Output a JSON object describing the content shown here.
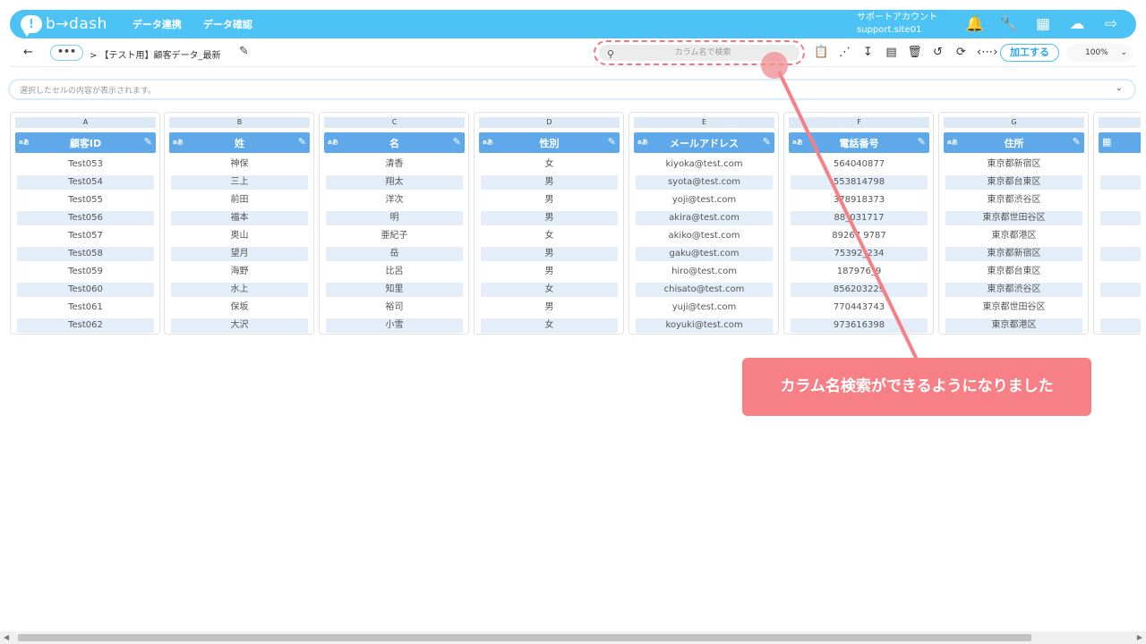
{
  "app": {
    "logo_mark": "!",
    "logo_text": "b→dash",
    "nav": [
      "データ連携",
      "データ確認"
    ],
    "account_name": "サポートアカウント",
    "account_site": "support.site01"
  },
  "top_icons": [
    "bell-icon",
    "wrench-icon",
    "grid-icon",
    "chat-icon",
    "logout-icon"
  ],
  "toolbar": {
    "back": "←",
    "more": "•••",
    "breadcrumb": "> 【テスト用】顧客データ_最新",
    "search_placeholder": "カラム名で検索",
    "process_button": "加工する",
    "zoom": "100%"
  },
  "cellbar": {
    "text": "選択したセルの内容が表示されます。"
  },
  "columns": [
    {
      "letter": "A",
      "type": "aあ",
      "name": "顧客ID",
      "cells": [
        "Test053",
        "Test054",
        "Test055",
        "Test056",
        "Test057",
        "Test058",
        "Test059",
        "Test060",
        "Test061",
        "Test062"
      ]
    },
    {
      "letter": "B",
      "type": "aあ",
      "name": "姓",
      "cells": [
        "神保",
        "三上",
        "前田",
        "福本",
        "奥山",
        "望月",
        "海野",
        "水上",
        "保坂",
        "大沢"
      ]
    },
    {
      "letter": "C",
      "type": "aあ",
      "name": "名",
      "cells": [
        "清香",
        "翔太",
        "洋次",
        "明",
        "亜紀子",
        "岳",
        "比呂",
        "知里",
        "裕司",
        "小雪"
      ]
    },
    {
      "letter": "D",
      "type": "aあ",
      "name": "性別",
      "cells": [
        "女",
        "男",
        "男",
        "男",
        "女",
        "男",
        "男",
        "女",
        "男",
        "女"
      ]
    },
    {
      "letter": "E",
      "type": "aあ",
      "name": "メールアドレス",
      "cells": [
        "kiyoka@test.com",
        "syota@test.com",
        "yoji@test.com",
        "akira@test.com",
        "akiko@test.com",
        "gaku@test.com",
        "hiro@test.com",
        "chisato@test.com",
        "yuji@test.com",
        "koyuki@test.com"
      ]
    },
    {
      "letter": "F",
      "type": "aあ",
      "name": "電話番号",
      "cells": [
        "564040877",
        "553814798",
        "378918373",
        "88_031717",
        "89267 9787",
        "75392_234",
        "187976_9",
        "856203229",
        "770443743",
        "973616398"
      ]
    },
    {
      "letter": "G",
      "type": "aあ",
      "name": "住所",
      "cells": [
        "東京都新宿区",
        "東京都台東区",
        "東京都渋谷区",
        "東京都世田谷区",
        "東京都港区",
        "東京都新宿区",
        "東京都台東区",
        "東京都渋谷区",
        "東京都世田谷区",
        "東京都港区"
      ]
    }
  ],
  "annotation": {
    "text": "カラム名検索ができるようになりました",
    "color": "#f78087"
  },
  "colors": {
    "brand": "#4dc3f5",
    "header": "#5fa9ea",
    "alt_row": "#e3eef8"
  }
}
